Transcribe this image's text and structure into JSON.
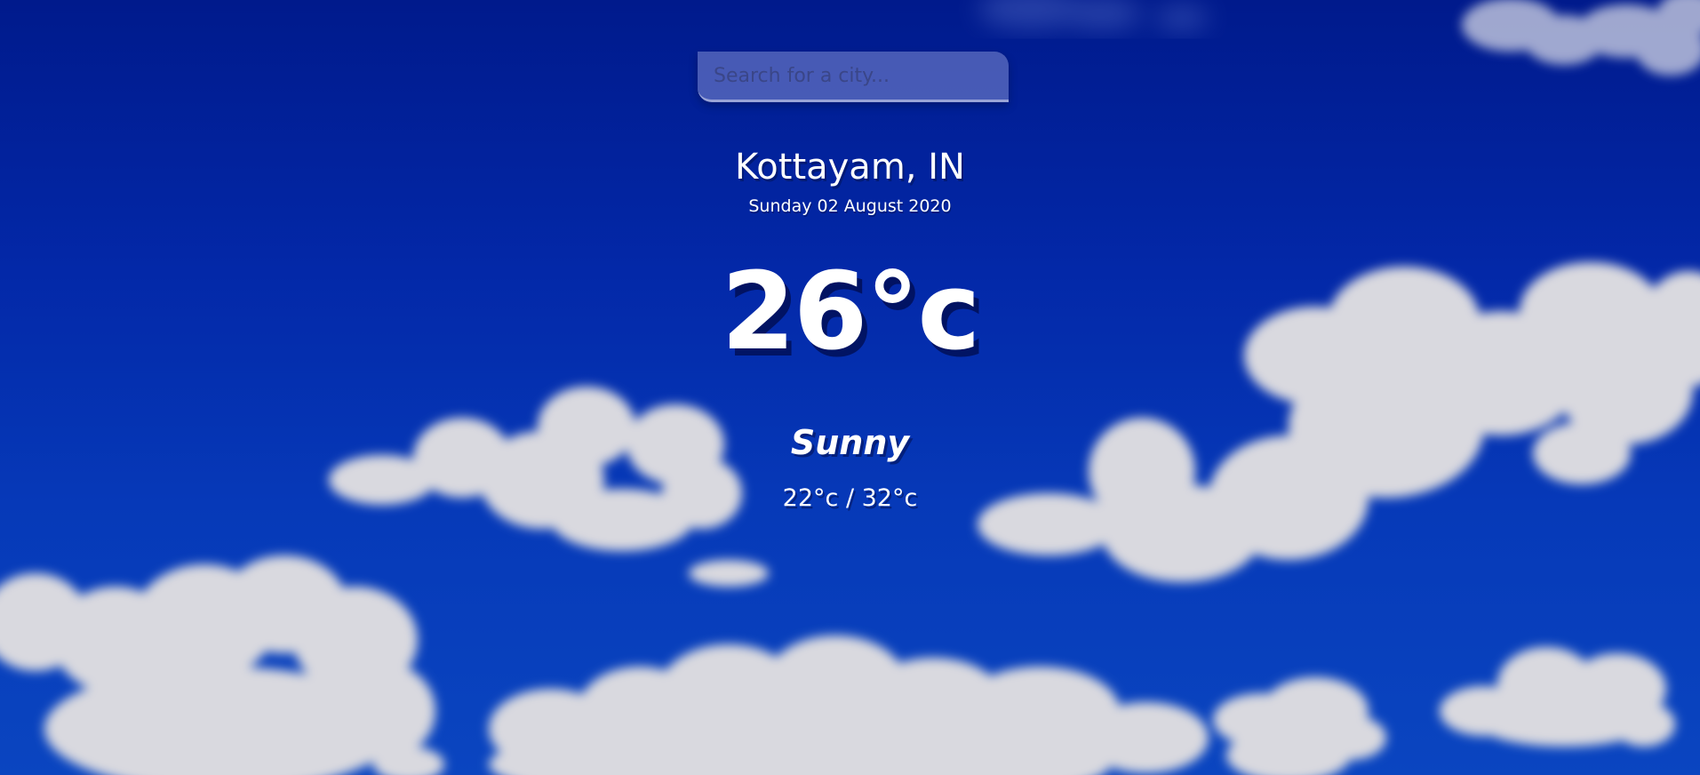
{
  "search": {
    "placeholder": "Search for a city...",
    "value": ""
  },
  "location": {
    "name": "Kottayam, IN",
    "date": "Sunday 02 August 2020"
  },
  "weather": {
    "temperature": "26°c",
    "condition": "Sunny",
    "hi_lo": "22°c / 32°c"
  },
  "background": {
    "theme": "blue sky with clouds",
    "sky_color": "#0328a8",
    "cloud_color": "#d9d9df"
  }
}
